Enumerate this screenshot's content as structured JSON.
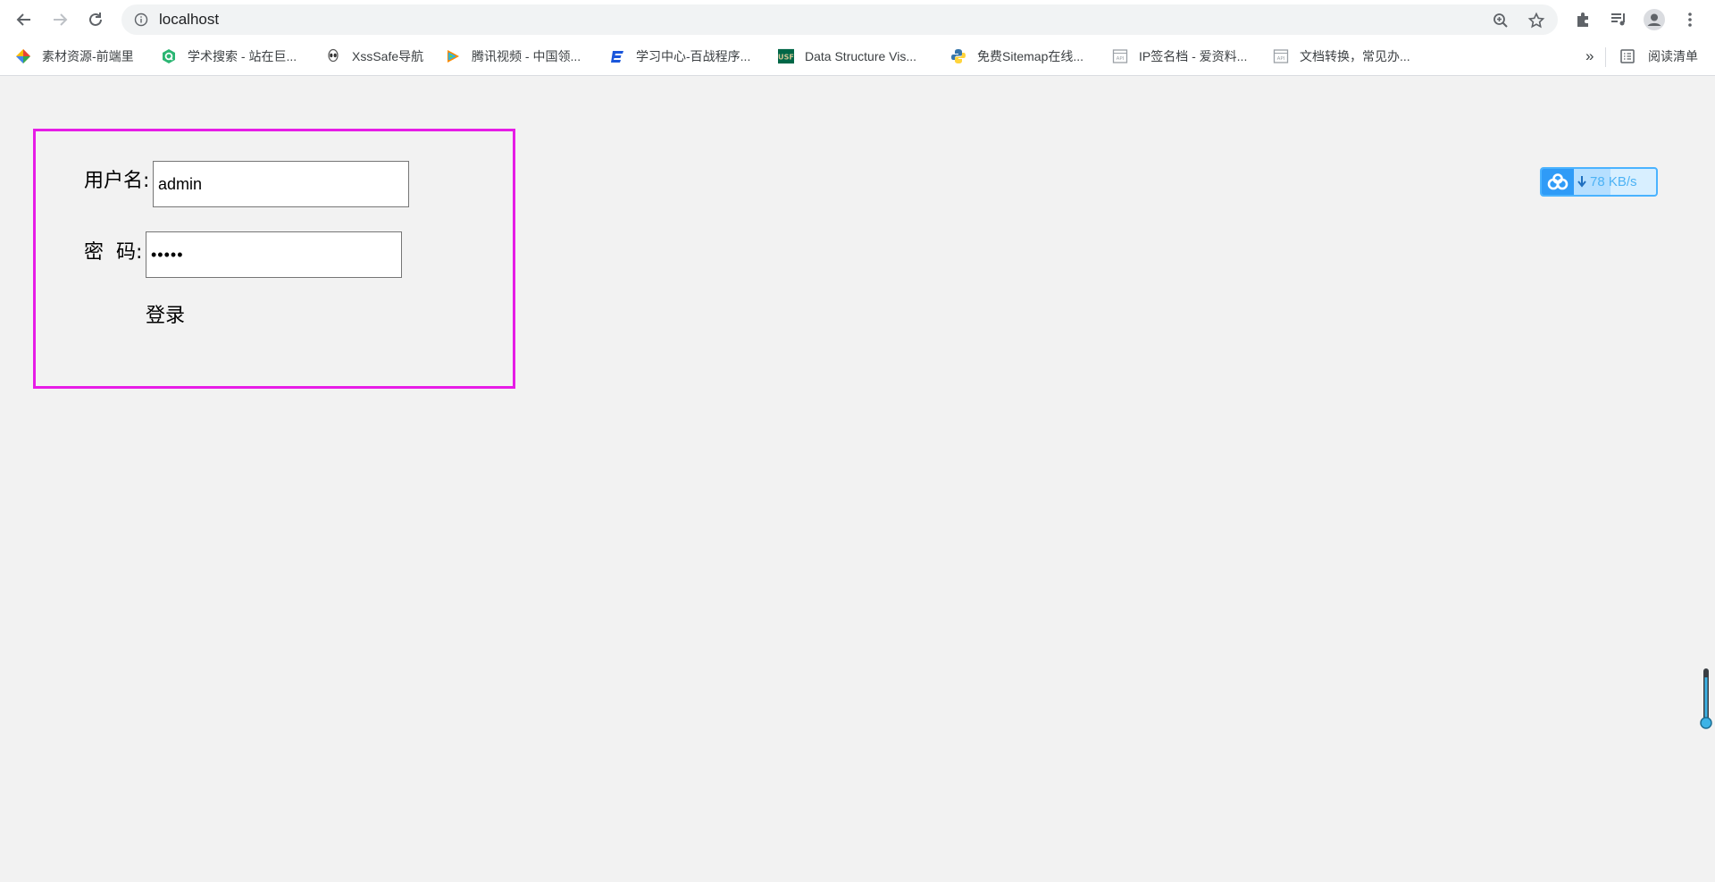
{
  "browser": {
    "url": "localhost",
    "bookmarks": [
      {
        "label": "素材资源-前端里",
        "icon": "diamond-logo-icon",
        "color": "#e94235"
      },
      {
        "label": "学术搜索 - 站在巨...",
        "icon": "green-q-icon",
        "color": "#2bb673"
      },
      {
        "label": "XssSafe导航",
        "icon": "alien-icon",
        "color": "#555555"
      },
      {
        "label": "腾讯视频 - 中国领...",
        "icon": "tencent-video-icon",
        "color": "#20b2ff"
      },
      {
        "label": "学习中心-百战程序...",
        "icon": "bz-logo-icon",
        "color": "#1a56db"
      },
      {
        "label": "Data Structure Vis...",
        "icon": "usf-logo-icon",
        "color": "#006747"
      },
      {
        "label": "免费Sitemap在线...",
        "icon": "python-icon",
        "color": "#3776ab"
      },
      {
        "label": "IP签名档 - 爱资料...",
        "icon": "api-page-icon",
        "color": "#9aa0a6"
      },
      {
        "label": "文档转换，常见办...",
        "icon": "api-page-icon",
        "color": "#9aa0a6"
      }
    ],
    "more_bookmarks": "»",
    "reading_list": "阅读清单"
  },
  "login": {
    "username_label": "用户名:",
    "username_value": "admin",
    "password_label": "密  码:",
    "password_value": "•••••",
    "submit_label": "登录",
    "border_color": "#e61de6"
  },
  "speed_widget": {
    "text": "78 KB/s",
    "fill_fraction": 0.45
  }
}
